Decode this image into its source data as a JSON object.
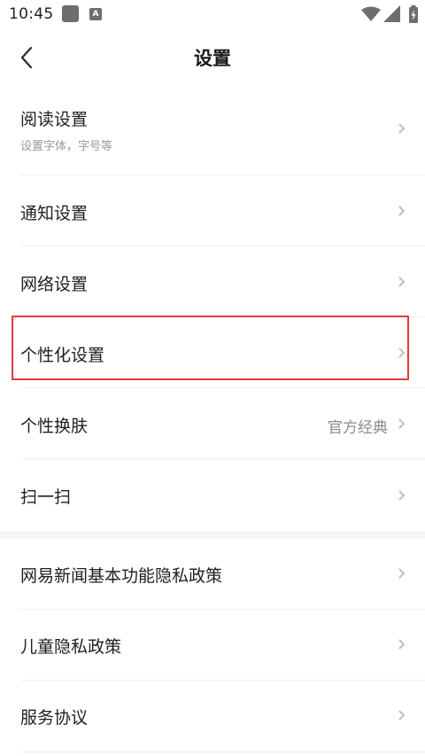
{
  "status_bar": {
    "time": "10:45",
    "notification_icons": [
      "square-notification-icon",
      "a-notification-icon"
    ],
    "system_icons": [
      "wifi-icon",
      "signal-icon",
      "battery-charging-icon"
    ],
    "a_glyph": "A"
  },
  "header": {
    "title": "设置",
    "back_icon": "chevron-left-icon"
  },
  "items": [
    {
      "label": "阅读设置",
      "sublabel": "设置字体，字号等"
    },
    {
      "label": "通知设置"
    },
    {
      "label": "网络设置"
    },
    {
      "label": "个性化设置",
      "highlighted": true
    },
    {
      "label": "个性换肤",
      "value": "官方经典"
    },
    {
      "label": "扫一扫"
    },
    {
      "label": "网易新闻基本功能隐私政策"
    },
    {
      "label": "儿童隐私政策"
    },
    {
      "label": "服务协议"
    }
  ],
  "colors": {
    "highlight_border": "#e03a3a",
    "section_gap": "#f4f4f4",
    "divider": "#efefef"
  }
}
